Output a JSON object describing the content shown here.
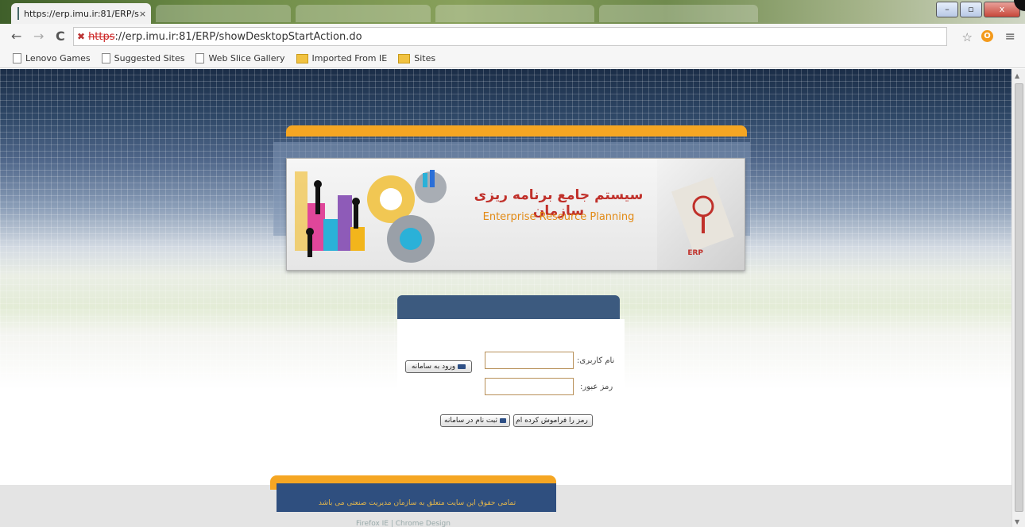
{
  "browser": {
    "tab_title": "https://erp.imu.ir:81/ERP/s",
    "tab_close": "×",
    "url_scheme": "https",
    "url_rest": "://erp.imu.ir:81/ERP/showDesktopStartAction.do",
    "back": "←",
    "forward": "→",
    "reload": "C",
    "star": "☆",
    "menu": "≡",
    "ext_label": "O",
    "win_min": "–",
    "win_max": "▫",
    "win_close": "x"
  },
  "bookmarks": [
    {
      "label": "Lenovo Games",
      "icon": "page-icon"
    },
    {
      "label": "Suggested Sites",
      "icon": "page-icon"
    },
    {
      "label": "Web Slice Gallery",
      "icon": "page-icon"
    },
    {
      "label": "Imported From IE",
      "icon": "folder-icon"
    },
    {
      "label": "Sites",
      "icon": "folder-icon"
    }
  ],
  "banner": {
    "title_fa": "سیستم جامع برنامه ریزی سازمان",
    "title_en": "Enterprise Resource Planning",
    "erp_tag": "ERP"
  },
  "login": {
    "username_label": "نام کاربری:",
    "password_label": "رمز عبور:",
    "login_button": "ورود به سامانه",
    "forgot_button": "رمز را فراموش کرده ام",
    "register_button": "ثبت نام در سامانه",
    "username_value": "",
    "password_value": ""
  },
  "footer": {
    "text": "تمامی حقوق این سایت متعلق به سازمان مدیریت صنعتی می باشد",
    "links": "Firefox IE  |  Chrome Design"
  },
  "colors": {
    "accent_orange": "#f5a623",
    "navy": "#2f4f7f",
    "title_red": "#c0302a"
  }
}
